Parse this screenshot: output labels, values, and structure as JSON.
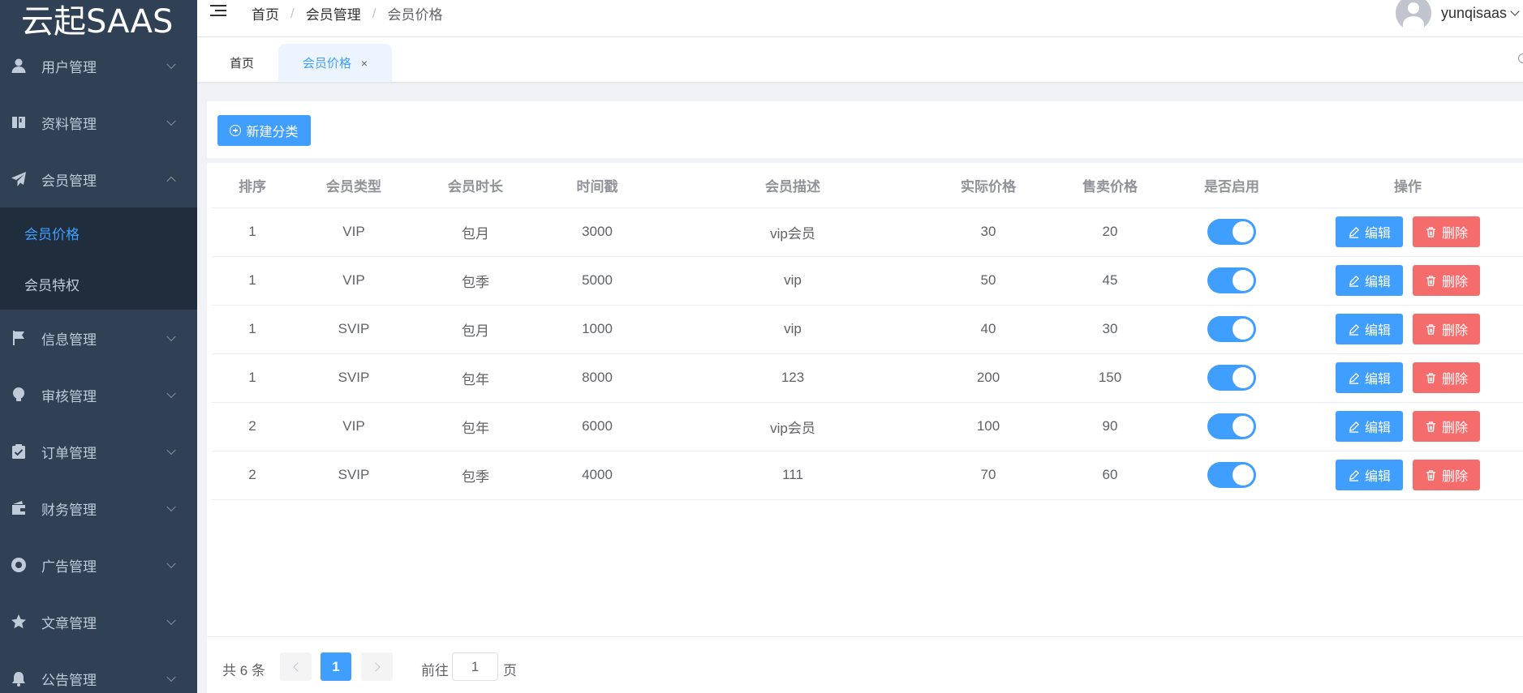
{
  "app": {
    "brand": "云起SAAS"
  },
  "sidebar": {
    "menus": [
      {
        "label": "用户管理",
        "icon": "user-icon",
        "expanded": false
      },
      {
        "label": "资料管理",
        "icon": "book-icon",
        "expanded": false
      },
      {
        "label": "会员管理",
        "icon": "paper-plane-icon",
        "expanded": true
      },
      {
        "label": "信息管理",
        "icon": "flag-icon",
        "expanded": false
      },
      {
        "label": "审核管理",
        "icon": "lightbulb-icon",
        "expanded": false
      },
      {
        "label": "订单管理",
        "icon": "clipboard-check-icon",
        "expanded": false
      },
      {
        "label": "财务管理",
        "icon": "wallet-icon",
        "expanded": false
      },
      {
        "label": "广告管理",
        "icon": "life-ring-icon",
        "expanded": false
      },
      {
        "label": "文章管理",
        "icon": "star-icon",
        "expanded": false
      },
      {
        "label": "公告管理",
        "icon": "bell-icon",
        "expanded": false
      }
    ],
    "submenu": [
      {
        "label": "会员价格",
        "active": true
      },
      {
        "label": "会员特权",
        "active": false
      }
    ]
  },
  "header": {
    "breadcrumb": [
      "首页",
      "会员管理",
      "会员价格"
    ],
    "separator": "/",
    "username": "yunqisaas"
  },
  "tags": {
    "home": "首页",
    "active": "会员价格",
    "close": "×"
  },
  "toolbar": {
    "new_label": "新建分类"
  },
  "table": {
    "columns": [
      "排序",
      "会员类型",
      "会员时长",
      "时间戳",
      "会员描述",
      "实际价格",
      "售卖价格",
      "是否启用",
      "操作"
    ],
    "rows": [
      {
        "sort": "1",
        "type": "VIP",
        "duration": "包月",
        "timestamp": "3000",
        "desc": "vip会员",
        "actual": "30",
        "sale": "20",
        "enabled": true
      },
      {
        "sort": "1",
        "type": "VIP",
        "duration": "包季",
        "timestamp": "5000",
        "desc": "vip",
        "actual": "50",
        "sale": "45",
        "enabled": true
      },
      {
        "sort": "1",
        "type": "SVIP",
        "duration": "包月",
        "timestamp": "1000",
        "desc": "vip",
        "actual": "40",
        "sale": "30",
        "enabled": true
      },
      {
        "sort": "1",
        "type": "SVIP",
        "duration": "包年",
        "timestamp": "8000",
        "desc": "123",
        "actual": "200",
        "sale": "150",
        "enabled": true
      },
      {
        "sort": "2",
        "type": "VIP",
        "duration": "包年",
        "timestamp": "6000",
        "desc": "vip会员",
        "actual": "100",
        "sale": "90",
        "enabled": true
      },
      {
        "sort": "2",
        "type": "SVIP",
        "duration": "包季",
        "timestamp": "4000",
        "desc": "111",
        "actual": "70",
        "sale": "60",
        "enabled": true
      }
    ],
    "edit_label": "编辑",
    "delete_label": "删除"
  },
  "pagination": {
    "total_text": "共 6 条",
    "current_page": "1",
    "goto_prefix": "前往",
    "goto_value": "1",
    "goto_suffix": "页"
  },
  "colors": {
    "sidebar_bg": "#304156",
    "submenu_bg": "#1f2d3d",
    "primary": "#409eff",
    "danger": "#f56c6c"
  }
}
